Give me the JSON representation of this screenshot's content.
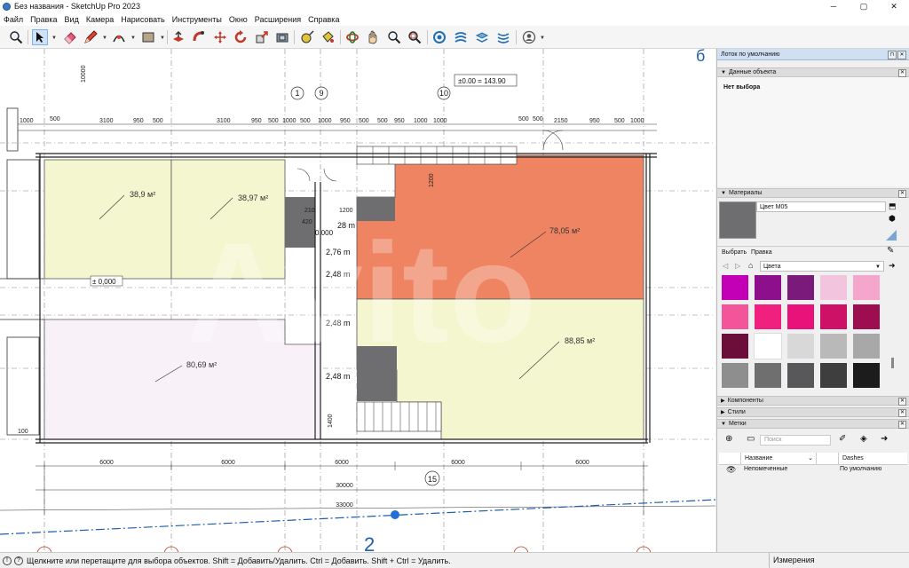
{
  "window": {
    "title": "Без названия - SketchUp Pro 2023",
    "minimize": "─",
    "maximize": "▢",
    "close": "✕"
  },
  "menu": [
    "Файл",
    "Правка",
    "Вид",
    "Камера",
    "Нарисовать",
    "Инструменты",
    "Окно",
    "Расширения",
    "Справка"
  ],
  "toolbar": {
    "tools": [
      "zoom-extents-icon",
      "select-icon",
      "eraser-icon",
      "pencil-icon",
      "arc-icon",
      "rectangle-icon",
      "push-pull-icon",
      "follow-me-icon",
      "move-icon",
      "rotate-icon",
      "scale-icon",
      "offset-icon",
      "tape-measure-icon",
      "paint-bucket-icon",
      "orbit-icon",
      "pan-icon",
      "zoom-icon",
      "zoom-window-icon",
      "section-plane-icon",
      "section-fill-icon",
      "section-cuts-icon",
      "section-display-icon",
      "user-icon"
    ]
  },
  "drawing": {
    "elevation": "±0.00 = 143.90",
    "level": "± 0,000",
    "level2": "0.000",
    "side_value": "10000",
    "right_axis": "б",
    "bottom_axis": "2",
    "axis_markers": [
      "1",
      "9",
      "10",
      "15"
    ],
    "rooms": [
      {
        "area": "38,9 м²"
      },
      {
        "area": "38,97 м²"
      },
      {
        "area": "78,05 м²"
      },
      {
        "area": "80,69 м²"
      },
      {
        "area": "88,85 м²"
      }
    ],
    "heights": [
      "2,48 m",
      "2,48 m",
      "2,48 m",
      "2,76 m"
    ],
    "height_top": "28 m",
    "top_dims": [
      "1000",
      "500",
      "3100",
      "950",
      "500",
      "3100",
      "950",
      "500",
      "1000",
      "500",
      "1000",
      "950",
      "500",
      "500",
      "950",
      "1000",
      "1000",
      "500",
      "500",
      "2150",
      "950",
      "500",
      "1000"
    ],
    "small_dims": [
      "210",
      "1200",
      "420",
      "1200",
      "1400"
    ],
    "bottom_dims": [
      "6000",
      "6000",
      "6000",
      "6000",
      "6000"
    ],
    "overall_dims": [
      "30000",
      "33000"
    ],
    "left_dim": "100",
    "watermark": "Avito"
  },
  "tray": {
    "title": "Лоток по умолчанию",
    "entity_info": {
      "header": "Данные объекта",
      "value": "Нет выбора"
    },
    "materials": {
      "header": "Материалы",
      "current": "Цвет M05",
      "current_color": "#6e6e70",
      "tab_select": "Выбрать",
      "tab_edit": "Правка",
      "library": "Цвета",
      "swatches": [
        "#c300b5",
        "#8d0f8c",
        "#7a1a7a",
        "#f2c4de",
        "#f5a6cc",
        "#f25599",
        "#f0207e",
        "#e8127a",
        "#cc1166",
        "#9c0e4f",
        "#6b0f3a",
        "#ffffff",
        "#d8d8d8",
        "#b9b9b9",
        "#a8a8a8",
        "#8e8e8e",
        "#6f6f6f",
        "#58585a",
        "#3e3e3e",
        "#1c1c1c"
      ]
    },
    "components": {
      "header": "Компоненты"
    },
    "styles": {
      "header": "Стили"
    },
    "tags": {
      "header": "Метки",
      "search_placeholder": "Поиск",
      "col_name": "Название",
      "col_dashes": "Dashes",
      "rows": [
        {
          "name": "Непомеченные",
          "dashes": "По умолчанию"
        }
      ]
    }
  },
  "status": {
    "message": "Щелкните или перетащите для выбора объектов. Shift = Добавить/Удалить. Ctrl = Добавить. Shift + Ctrl = Удалить.",
    "measurements_label": "Измерения"
  }
}
